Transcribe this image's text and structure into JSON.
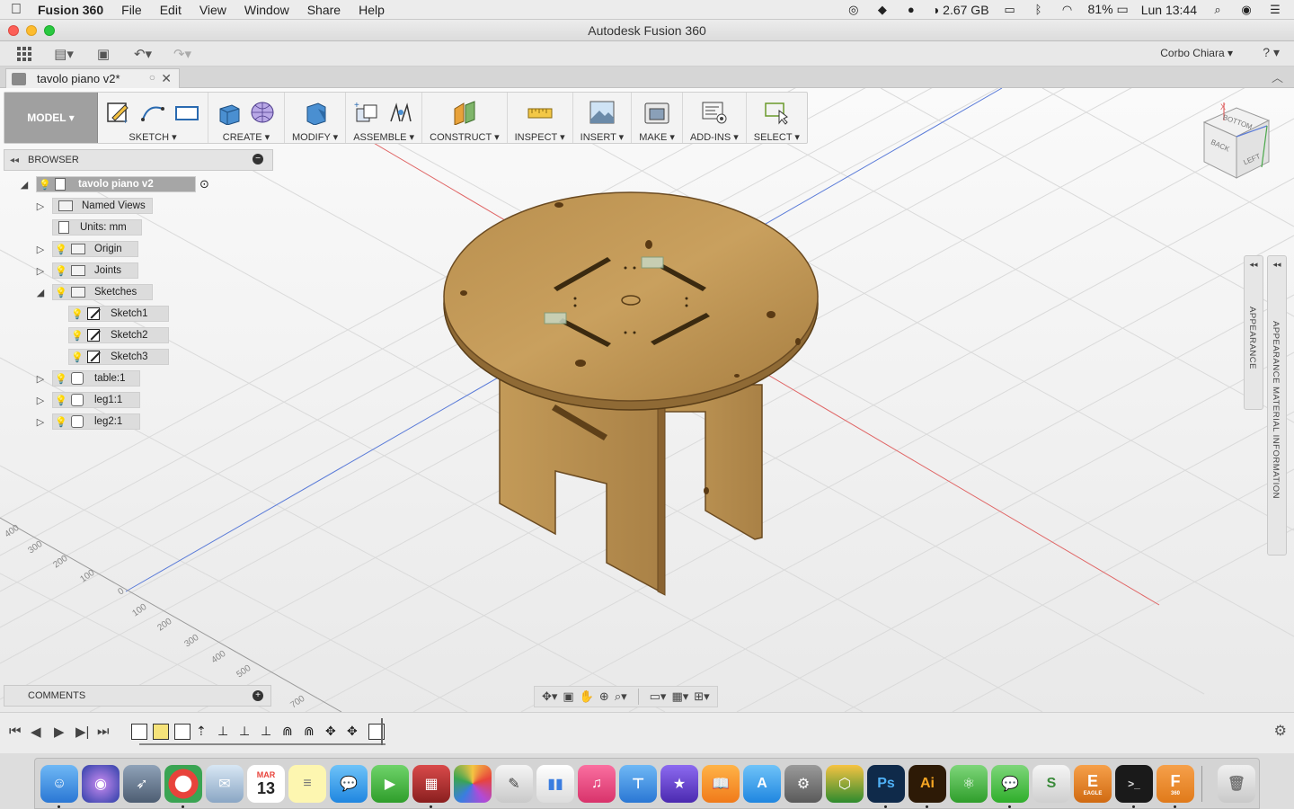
{
  "menubar": {
    "apple": "",
    "app_name": "Fusion 360",
    "menus": [
      "File",
      "Edit",
      "View",
      "Window",
      "Share",
      "Help"
    ],
    "memory": "2.67 GB",
    "battery": "81%",
    "clock": "Lun 13:44"
  },
  "window": {
    "title": "Autodesk Fusion 360"
  },
  "quickbar": {
    "user": "Corbo Chiara ▾",
    "help": "? ▾"
  },
  "tab": {
    "name": "tavolo piano v2*",
    "close": "✕"
  },
  "toolbar": {
    "workspace": "MODEL ▾",
    "groups": {
      "sketch": "SKETCH ▾",
      "create": "CREATE ▾",
      "modify": "MODIFY ▾",
      "assemble": "ASSEMBLE ▾",
      "construct": "CONSTRUCT ▾",
      "inspect": "INSPECT ▾",
      "insert": "INSERT ▾",
      "make": "MAKE ▾",
      "addins": "ADD-INS ▾",
      "select": "SELECT ▾"
    }
  },
  "browser": {
    "title": "BROWSER",
    "root": "tavolo piano v2",
    "named_views": "Named Views",
    "units": "Units: mm",
    "origin": "Origin",
    "joints": "Joints",
    "sketches": "Sketches",
    "sketch1": "Sketch1",
    "sketch2": "Sketch2",
    "sketch3": "Sketch3",
    "table": "table:1",
    "leg1": "leg1:1",
    "leg2": "leg2:1"
  },
  "comments": {
    "title": "COMMENTS"
  },
  "right_panels": {
    "appearance": "APPEARANCE",
    "material_info": "APPEARANCE MATERIAL INFORMATION"
  },
  "viewcube": {
    "face_top": "BOTTOM",
    "face_left": "BACK",
    "face_right": "LEFT"
  },
  "grid_labels": [
    "400",
    "300",
    "200",
    "100",
    "0",
    "100",
    "200",
    "300",
    "400",
    "500",
    "700"
  ],
  "dock": {
    "calendar_month": "MAR",
    "calendar_day": "13",
    "ps": "Ps",
    "ai": "Ai",
    "eagle": "E",
    "eagle_label": "EAGLE",
    "fusion": "F",
    "fusion_label": "360"
  },
  "colors": {
    "accent_model": "#a0a0a0",
    "wood": "#c49a5a",
    "grid_red": "#e06666",
    "grid_blue": "#5a7bd8"
  }
}
